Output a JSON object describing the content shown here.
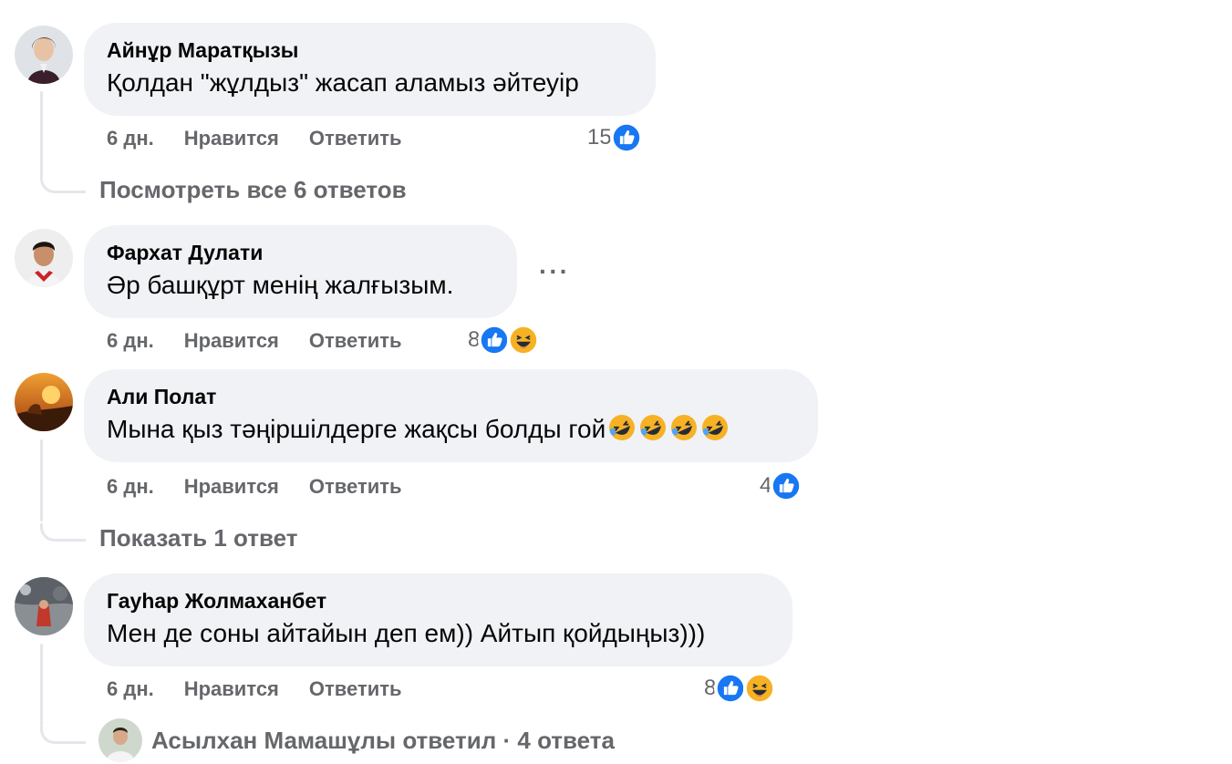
{
  "comments": [
    {
      "author": "Айнұр Маратқызы",
      "text": "Қолдан \"жұлдыз\" жасап аламыз әйтеуір",
      "time": "6 дн.",
      "like": "Нравится",
      "reply": "Ответить",
      "reaction_count": "15",
      "replies_link": "Посмотреть все 6 ответов"
    },
    {
      "author": "Фархат Дулати",
      "text": "Әр башқұрт менің жалғызым.",
      "time": "6 дн.",
      "like": "Нравится",
      "reply": "Ответить",
      "reaction_count": "8",
      "more": "···"
    },
    {
      "author": "Али Полат",
      "text": "Мына қыз тәңіршілдерге жақсы болды гой",
      "emojis": [
        "rofl-icon",
        "rofl-icon",
        "rofl-icon",
        "rofl-icon"
      ],
      "time": "6 дн.",
      "like": "Нравится",
      "reply": "Ответить",
      "reaction_count": "4",
      "replies_link": "Показать 1 ответ"
    },
    {
      "author": "Гауһар Жолмаханбет",
      "text": "Мен де соны айтайын деп ем)) Айтып қойдыңыз)))",
      "time": "6 дн.",
      "like": "Нравится",
      "reply": "Ответить",
      "reaction_count": "8",
      "replies_link": "Асылхан Мамашұлы ответил · 4 ответа"
    }
  ],
  "colors": {
    "bubble": "#f0f2f5",
    "meta": "#65676b",
    "like_blue": "#1877f2",
    "haha_yellow": "#f7b125"
  }
}
